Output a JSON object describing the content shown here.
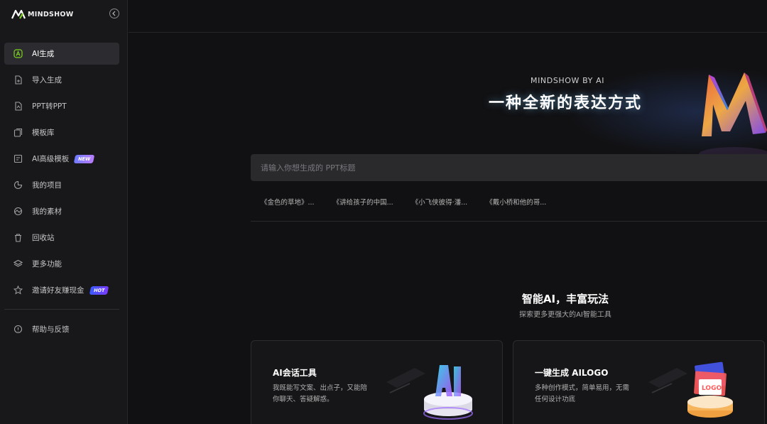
{
  "brand": {
    "name": "MINDSHOW",
    "accent": "#7ed321"
  },
  "sidebar": {
    "items": [
      {
        "label": "AI生成",
        "icon": "ai-icon",
        "active": true
      },
      {
        "label": "导入生成",
        "icon": "import-file-icon"
      },
      {
        "label": "PPT转PPT",
        "icon": "convert-icon"
      },
      {
        "label": "模板库",
        "icon": "template-icon"
      },
      {
        "label": "AI高级模板",
        "icon": "advanced-template-icon",
        "badge": "NEW"
      },
      {
        "label": "我的项目",
        "icon": "project-icon"
      },
      {
        "label": "我的素材",
        "icon": "asset-icon"
      },
      {
        "label": "回收站",
        "icon": "trash-icon"
      },
      {
        "label": "更多功能",
        "icon": "layers-icon"
      },
      {
        "label": "邀请好友赚现金",
        "icon": "star-icon",
        "badge": "HOT"
      }
    ],
    "help": {
      "label": "帮助与反馈",
      "icon": "help-icon"
    }
  },
  "hero": {
    "subtitle": "MINDSHOW BY AI",
    "title": "一种全新的表达方式"
  },
  "search": {
    "placeholder": "请输入你想生成的 PPT标题"
  },
  "suggestions": [
    "《金色的草地》...",
    "《讲给孩子的中国...",
    "《小飞侠彼得·潘...",
    "《戴小桥和他的哥..."
  ],
  "section": {
    "title": "智能AI，丰富玩法",
    "subtitle": "探索更多更强大的AI智能工具"
  },
  "cards": [
    {
      "title": "AI会话工具",
      "desc": "我既能写文案、出点子，又能陪你聊天、答疑解惑。"
    },
    {
      "title": "一键生成 AILOGO",
      "desc": "多种创作模式，简单易用，无需任何设计功底"
    }
  ]
}
